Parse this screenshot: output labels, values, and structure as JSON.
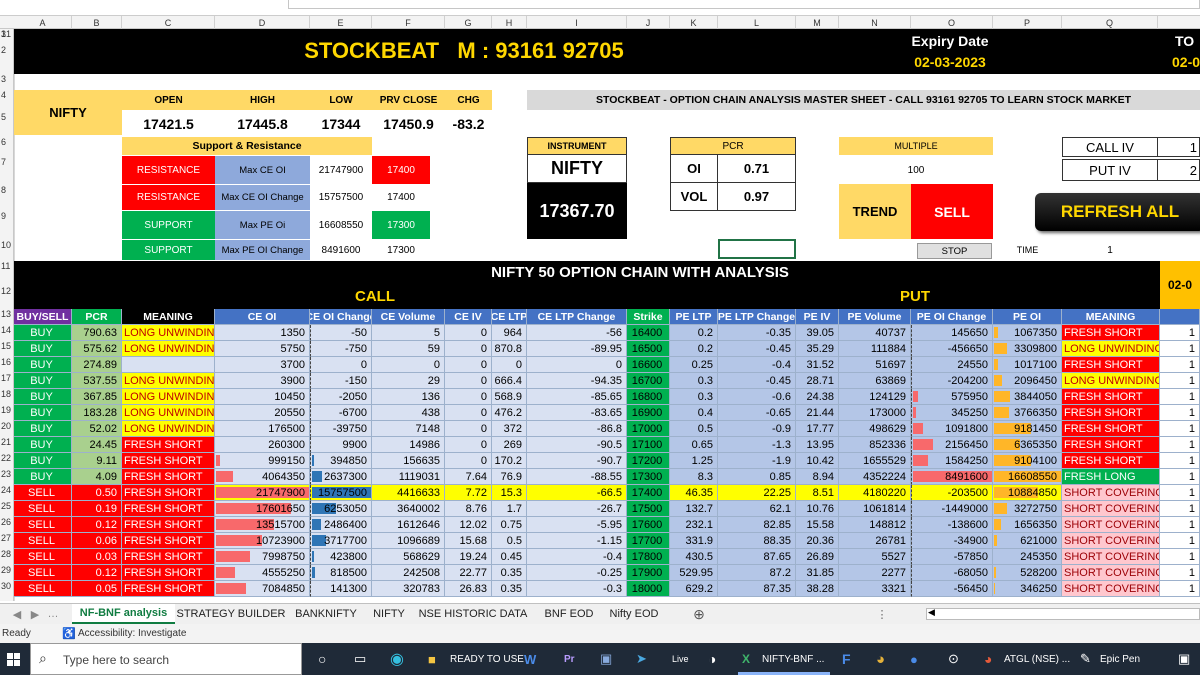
{
  "title": {
    "brand": "STOCKBEAT   M : 93161 92705",
    "expiry_label": "Expiry Date",
    "expiry_value": "02-03-2023",
    "to_label": "TO",
    "to_value": "02-0"
  },
  "columns": [
    "A",
    "B",
    "C",
    "D",
    "E",
    "F",
    "G",
    "H",
    "I",
    "J",
    "K",
    "L",
    "M",
    "N",
    "O",
    "P",
    "Q"
  ],
  "rows": [
    "1",
    "2",
    "3",
    "4",
    "5",
    "6",
    "7",
    "8",
    "9",
    "10",
    "11",
    "12",
    "13",
    "14",
    "15",
    "16",
    "17",
    "18",
    "19",
    "20",
    "21",
    "22",
    "23",
    "24",
    "25",
    "26",
    "27",
    "28",
    "29",
    "30",
    "31"
  ],
  "summary": {
    "symbol": "NIFTY",
    "open_l": "OPEN",
    "high_l": "HIGH",
    "low_l": "LOW",
    "prv_l": "PRV CLOSE",
    "chg_l": "CHG",
    "open": "17421.5",
    "high": "17445.8",
    "low": "17344",
    "prv": "17450.9",
    "chg": "-83.2"
  },
  "banner": "STOCKBEAT - OPTION CHAIN ANALYSIS MASTER SHEET - CALL 93161 92705 TO LEARN STOCK MARKET",
  "sr": {
    "title": "Support & Resistance",
    "r1": "RESISTANCE",
    "r1k": "Max CE OI",
    "r1v": "21747900",
    "r1s": "17400",
    "r2": "RESISTANCE",
    "r2k": "Max CE OI Change",
    "r2v": "15757500",
    "r2s": "17400",
    "s1": "SUPPORT",
    "s1k": "Max PE Oi",
    "s1v": "16608550",
    "s1s": "17300",
    "s2": "SUPPORT",
    "s2k": "Max PE OI Change",
    "s2v": "8491600",
    "s2s": "17300"
  },
  "instrument": {
    "label": "INSTRUMENT",
    "name": "NIFTY",
    "price": "17367.70"
  },
  "pcr": {
    "label": "PCR",
    "oi_l": "OI",
    "oi": "0.71",
    "vol_l": "VOL",
    "vol": "0.97"
  },
  "multiple": {
    "label": "MULTIPLE",
    "value": "100"
  },
  "trend": {
    "label": "TREND",
    "value": "SELL"
  },
  "iv": {
    "call_l": "CALL IV",
    "call_v": "1",
    "put_l": "PUT IV",
    "put_v": "2"
  },
  "refresh": "REFRESH ALL",
  "stop": "STOP",
  "time_l": "TIME",
  "time_v": "1",
  "chain": {
    "title": "NIFTY 50 OPTION CHAIN WITH ANALYSIS",
    "call": "CALL",
    "put": "PUT",
    "date_tag": "02-0",
    "headers": [
      "BUY/SELL",
      "PCR",
      "MEANING",
      "CE OI",
      "CE OI Change",
      "CE Volume",
      "CE IV",
      "CE LTP",
      "CE LTP Change",
      "Strike",
      "PE LTP",
      "PE LTP Change",
      "PE IV",
      "PE Volume",
      "PE OI Change",
      "PE OI",
      "MEANING"
    ],
    "rows": [
      [
        "BUY",
        "790.63",
        "LONG UNWINDING",
        "1350",
        "-50",
        "5",
        "0",
        "964",
        "-56",
        "16400",
        "0.2",
        "-0.35",
        "39.05",
        "40737",
        "145650",
        "1067350",
        "FRESH SHORT",
        "1"
      ],
      [
        "BUY",
        "575.62",
        "LONG UNWINDING",
        "5750",
        "-750",
        "59",
        "0",
        "870.8",
        "-89.95",
        "16500",
        "0.2",
        "-0.45",
        "35.29",
        "111884",
        "-456650",
        "3309800",
        "LONG UNWINDING",
        "1"
      ],
      [
        "BUY",
        "274.89",
        "",
        "3700",
        "0",
        "0",
        "0",
        "0",
        "0",
        "16600",
        "0.25",
        "-0.4",
        "31.52",
        "51697",
        "24550",
        "1017100",
        "FRESH SHORT",
        "1"
      ],
      [
        "BUY",
        "537.55",
        "LONG UNWINDING",
        "3900",
        "-150",
        "29",
        "0",
        "666.4",
        "-94.35",
        "16700",
        "0.3",
        "-0.45",
        "28.71",
        "63869",
        "-204200",
        "2096450",
        "LONG UNWINDING",
        "1"
      ],
      [
        "BUY",
        "367.85",
        "LONG UNWINDING",
        "10450",
        "-2050",
        "136",
        "0",
        "568.9",
        "-85.65",
        "16800",
        "0.3",
        "-0.6",
        "24.38",
        "124129",
        "575950",
        "3844050",
        "FRESH SHORT",
        "1"
      ],
      [
        "BUY",
        "183.28",
        "LONG UNWINDING",
        "20550",
        "-6700",
        "438",
        "0",
        "476.2",
        "-83.65",
        "16900",
        "0.4",
        "-0.65",
        "21.44",
        "173000",
        "345250",
        "3766350",
        "FRESH SHORT",
        "1"
      ],
      [
        "BUY",
        "52.02",
        "LONG UNWINDING",
        "176500",
        "-39750",
        "7148",
        "0",
        "372",
        "-86.8",
        "17000",
        "0.5",
        "-0.9",
        "17.77",
        "498629",
        "1091800",
        "9181450",
        "FRESH SHORT",
        "1"
      ],
      [
        "BUY",
        "24.45",
        "FRESH SHORT",
        "260300",
        "9900",
        "14986",
        "0",
        "269",
        "-90.5",
        "17100",
        "0.65",
        "-1.3",
        "13.95",
        "852336",
        "2156450",
        "6365350",
        "FRESH SHORT",
        "1"
      ],
      [
        "BUY",
        "9.11",
        "FRESH SHORT",
        "999150",
        "394850",
        "156635",
        "0",
        "170.2",
        "-90.7",
        "17200",
        "1.25",
        "-1.9",
        "10.42",
        "1655529",
        "1584250",
        "9104100",
        "FRESH SHORT",
        "1"
      ],
      [
        "BUY",
        "4.09",
        "FRESH SHORT",
        "4064350",
        "2637300",
        "1119031",
        "7.64",
        "76.9",
        "-88.55",
        "17300",
        "8.3",
        "0.85",
        "8.94",
        "4352224",
        "8491600",
        "16608550",
        "FRESH LONG",
        "1"
      ],
      [
        "SELL",
        "0.50",
        "FRESH SHORT",
        "21747900",
        "15757500",
        "4416633",
        "7.72",
        "15.3",
        "-66.5",
        "17400",
        "46.35",
        "22.25",
        "8.51",
        "4180220",
        "-203500",
        "10884850",
        "SHORT COVERING",
        "1"
      ],
      [
        "SELL",
        "0.19",
        "FRESH SHORT",
        "17601650",
        "6253050",
        "3640002",
        "8.76",
        "1.7",
        "-26.7",
        "17500",
        "132.7",
        "62.1",
        "10.76",
        "1061814",
        "-1449000",
        "3272750",
        "SHORT COVERING",
        "1"
      ],
      [
        "SELL",
        "0.12",
        "FRESH SHORT",
        "13515700",
        "2486400",
        "1612646",
        "12.02",
        "0.75",
        "-5.95",
        "17600",
        "232.1",
        "82.85",
        "15.58",
        "148812",
        "-138600",
        "1656350",
        "SHORT COVERING",
        "1"
      ],
      [
        "SELL",
        "0.06",
        "FRESH SHORT",
        "10723900",
        "3717700",
        "1096689",
        "15.68",
        "0.5",
        "-1.15",
        "17700",
        "331.9",
        "88.35",
        "20.36",
        "26781",
        "-34900",
        "621000",
        "SHORT COVERING",
        "1"
      ],
      [
        "SELL",
        "0.03",
        "FRESH SHORT",
        "7998750",
        "423800",
        "568629",
        "19.24",
        "0.45",
        "-0.4",
        "17800",
        "430.5",
        "87.65",
        "26.89",
        "5527",
        "-57850",
        "245350",
        "SHORT COVERING",
        "1"
      ],
      [
        "SELL",
        "0.12",
        "FRESH SHORT",
        "4555250",
        "818500",
        "242508",
        "22.77",
        "0.35",
        "-0.25",
        "17900",
        "529.95",
        "87.2",
        "31.85",
        "2277",
        "-68050",
        "528200",
        "SHORT COVERING",
        "1"
      ],
      [
        "SELL",
        "0.05",
        "FRESH SHORT",
        "7084850",
        "141300",
        "320783",
        "26.83",
        "0.35",
        "-0.3",
        "18000",
        "629.2",
        "87.35",
        "38.28",
        "3321",
        "-56450",
        "346250",
        "SHORT COVERING",
        "1"
      ]
    ]
  },
  "tabs": [
    "NF-BNF analysis",
    "STRATEGY BUILDER",
    "BANKNIFTY",
    "NIFTY",
    "NSE HISTORIC DATA",
    "BNF EOD",
    "Nifty EOD"
  ],
  "status": {
    "ready": "Ready",
    "access": "Accessibility: Investigate"
  },
  "taskbar": {
    "search": "Type here to search",
    "apps": [
      "READY TO USE",
      "NIFTY-BNF ...",
      "ATGL (NSE) ...",
      "Epic Pen"
    ],
    "live": "Live"
  },
  "colors": {
    "green": "#00b050",
    "red": "#ff0000",
    "blue": "#4472c4",
    "yellow": "#ffff00",
    "purple": "#7030a0",
    "black": "#000000",
    "gold": "#ffd700"
  }
}
